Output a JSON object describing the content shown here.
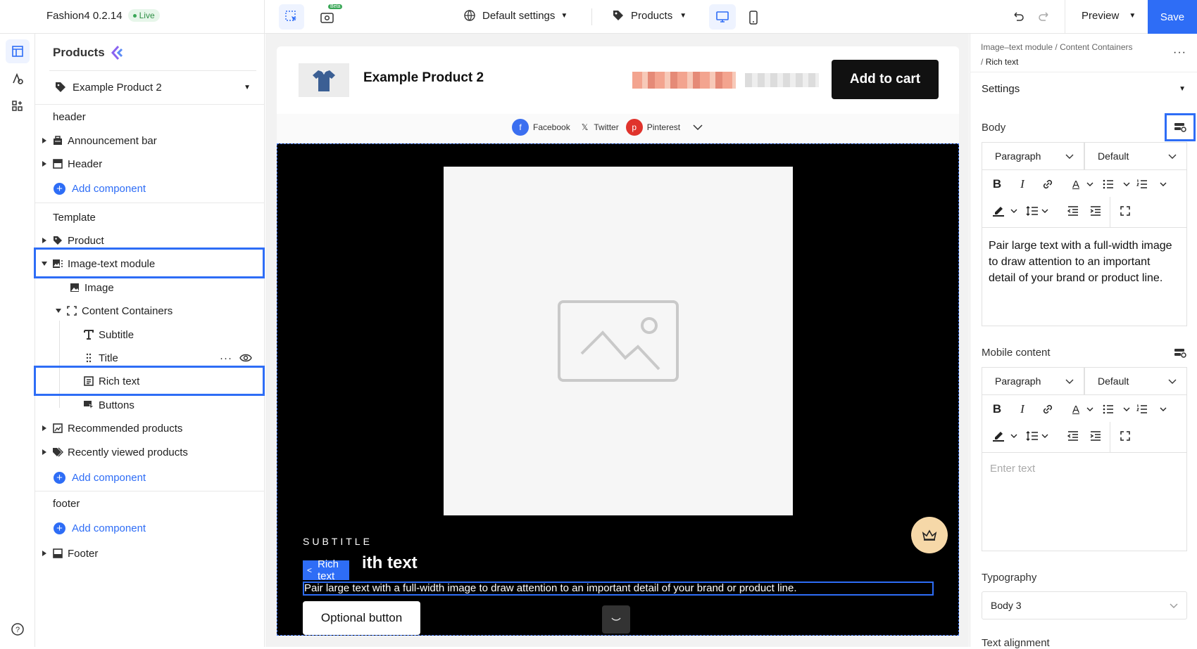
{
  "app": {
    "name": "Fashion4",
    "version": "0.2.14",
    "status": "Live",
    "beta_badge": "Beta"
  },
  "toolbar": {
    "settings_label": "Default settings",
    "page_type_label": "Products",
    "preview_label": "Preview",
    "save_label": "Save"
  },
  "left_panel": {
    "title": "Products",
    "product_select": "Example Product 2",
    "header_section": "header",
    "header_items": [
      "Announcement bar",
      "Header"
    ],
    "add_component": "Add component",
    "template_section": "Template",
    "template_items": {
      "product": "Product",
      "image_text_module": "Image-text module",
      "image": "Image",
      "content_containers": "Content Containers",
      "subtitle": "Subtitle",
      "title": "Title",
      "rich_text": "Rich text",
      "buttons": "Buttons",
      "recommended": "Recommended products",
      "recently_viewed": "Recently viewed products"
    },
    "footer_section": "footer",
    "footer_item": "Footer"
  },
  "canvas": {
    "product_name": "Example Product 2",
    "add_to_cart": "Add to cart",
    "share": [
      "Facebook",
      "Twitter",
      "Pinterest"
    ],
    "subtitle": "SUBTITLE",
    "title_visible": "ith text",
    "rich_text_tag": "Rich text",
    "body_text": "Pair large text with a full-width image to draw attention to an important detail of your brand or product line.",
    "button_label": "Optional button"
  },
  "right_panel": {
    "breadcrumb_1": "Image–text module",
    "breadcrumb_sep": "/",
    "breadcrumb_2": "Content Containers",
    "breadcrumb_3": "Rich text",
    "settings_label": "Settings",
    "body_label": "Body",
    "paragraph_select": "Paragraph",
    "default_select": "Default",
    "body_text": "Pair large text with a full-width image to draw attention to an important detail of your brand or product line.",
    "mobile_label": "Mobile content",
    "mobile_placeholder": "Enter text",
    "typography_label": "Typography",
    "typography_value": "Body 3",
    "text_alignment_label": "Text alignment"
  },
  "colors": {
    "accent": "#2e6df6",
    "live_green": "#3aa757",
    "cart_bg": "#111111",
    "canvas_bg": "#000000"
  }
}
